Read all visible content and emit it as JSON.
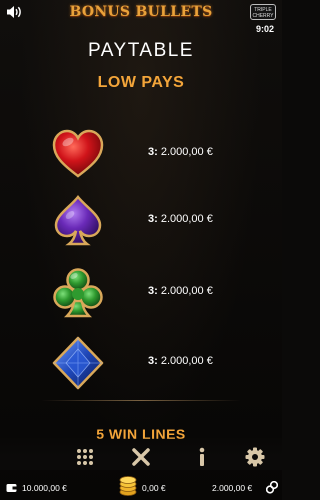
{
  "header": {
    "game_logo": "BONUS BULLETS",
    "provider_logo": "TRIPLE CHERRY",
    "clock": "9:02"
  },
  "paytable": {
    "title": "PAYTABLE",
    "subtitle": "LOW PAYS",
    "rows": [
      {
        "symbol": "heart-icon",
        "count": "3:",
        "amount": "2.000,00 €",
        "color": "#d0141a"
      },
      {
        "symbol": "spade-icon",
        "count": "3:",
        "amount": "2.000,00 €",
        "color": "#6a2ab8"
      },
      {
        "symbol": "club-icon",
        "count": "3:",
        "amount": "2.000,00 €",
        "color": "#2f9a2f"
      },
      {
        "symbol": "diamond-icon",
        "count": "3:",
        "amount": "2.000,00 €",
        "color": "#1f47b8"
      }
    ],
    "next_section": "5 WIN LINES"
  },
  "nav": [
    "menu-grid-icon",
    "close-icon",
    "info-icon",
    "settings-gear-icon"
  ],
  "status": {
    "balance": "10.000,00 €",
    "win": "0,00 €",
    "bet": "2.000,00 €"
  },
  "colors": {
    "accent": "#f3a53a",
    "frame_gold": "#c9974a"
  }
}
